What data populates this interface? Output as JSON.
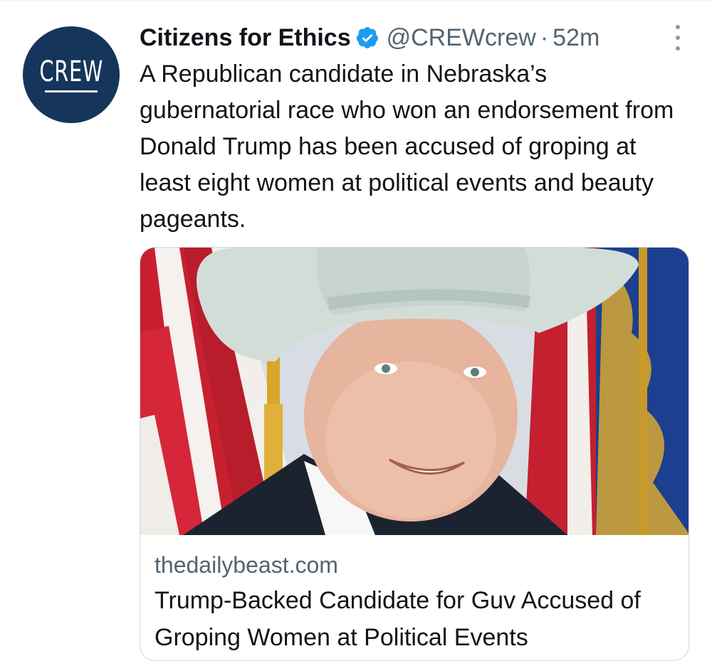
{
  "tweet": {
    "author": {
      "avatar_text": "CREW",
      "name": "Citizens for Ethics",
      "handle": "@CREWcrew",
      "separator": "·",
      "time": "52m",
      "verified": true
    },
    "text": "A Republican candidate in Nebraska’s gubernatorial race who won an endorsement from Donald Trump has been accused of groping at least eight women at political events and beauty pageants."
  },
  "card": {
    "domain": "thedailybeast.com",
    "title": "Trump-Backed Candidate for Guv Accused of Groping Women at Political Events"
  },
  "colors": {
    "avatar_bg": "#15365a",
    "verified_blue": "#1d9bf0",
    "secondary_text": "#536471",
    "border": "#cfd9de"
  },
  "icons": {
    "verified": "verified-badge-icon",
    "more": "more-options-icon"
  }
}
